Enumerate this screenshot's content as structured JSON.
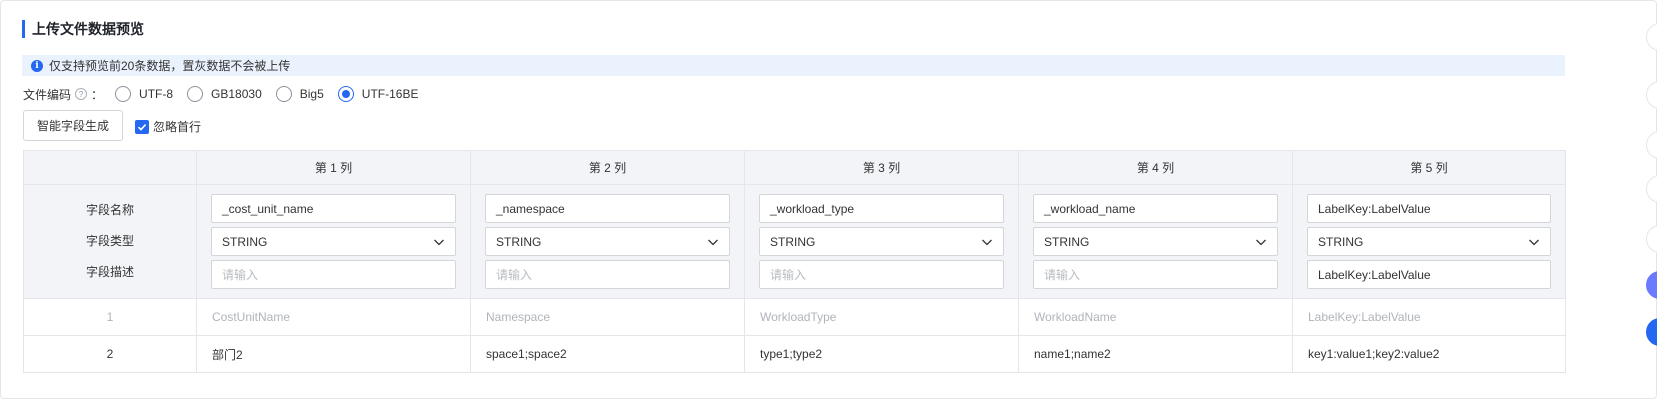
{
  "panel": {
    "title": "上传文件数据预览",
    "notice": "仅支持预览前20条数据，置灰数据不会被上传"
  },
  "encoding": {
    "label": "文件编码",
    "colon": "：",
    "options": [
      "UTF-8",
      "GB18030",
      "Big5",
      "UTF-16BE"
    ],
    "selected": "UTF-16BE"
  },
  "actions": {
    "generate_label": "智能字段生成",
    "ignore_first_row_label": "忽略首行",
    "ignore_first_row_checked": true
  },
  "table": {
    "columns": [
      "第 1 列",
      "第 2 列",
      "第 3 列",
      "第 4 列",
      "第 5 列"
    ],
    "config_labels": [
      "字段名称",
      "字段类型",
      "字段描述"
    ],
    "field_names": [
      "_cost_unit_name",
      "_namespace",
      "_workload_type",
      "_workload_name",
      "LabelKey:LabelValue"
    ],
    "field_types": [
      "STRING",
      "STRING",
      "STRING",
      "STRING",
      "STRING"
    ],
    "field_descs": [
      "",
      "",
      "",
      "",
      "LabelKey:LabelValue"
    ],
    "desc_placeholder": "请输入",
    "rows": [
      {
        "num": "1",
        "grayed": true,
        "cells": [
          "CostUnitName",
          "Namespace",
          "WorkloadType",
          "WorkloadName",
          "LabelKey:LabelValue"
        ]
      },
      {
        "num": "2",
        "grayed": false,
        "cells": [
          "部门2",
          "space1;space2",
          "type1;type2",
          "name1;name2",
          "key1:value1;key2:value2"
        ]
      }
    ]
  },
  "colors": {
    "accent": "#2468f2",
    "header_bg": "#f2f4f8",
    "notice_bg": "#eaf2fe"
  }
}
